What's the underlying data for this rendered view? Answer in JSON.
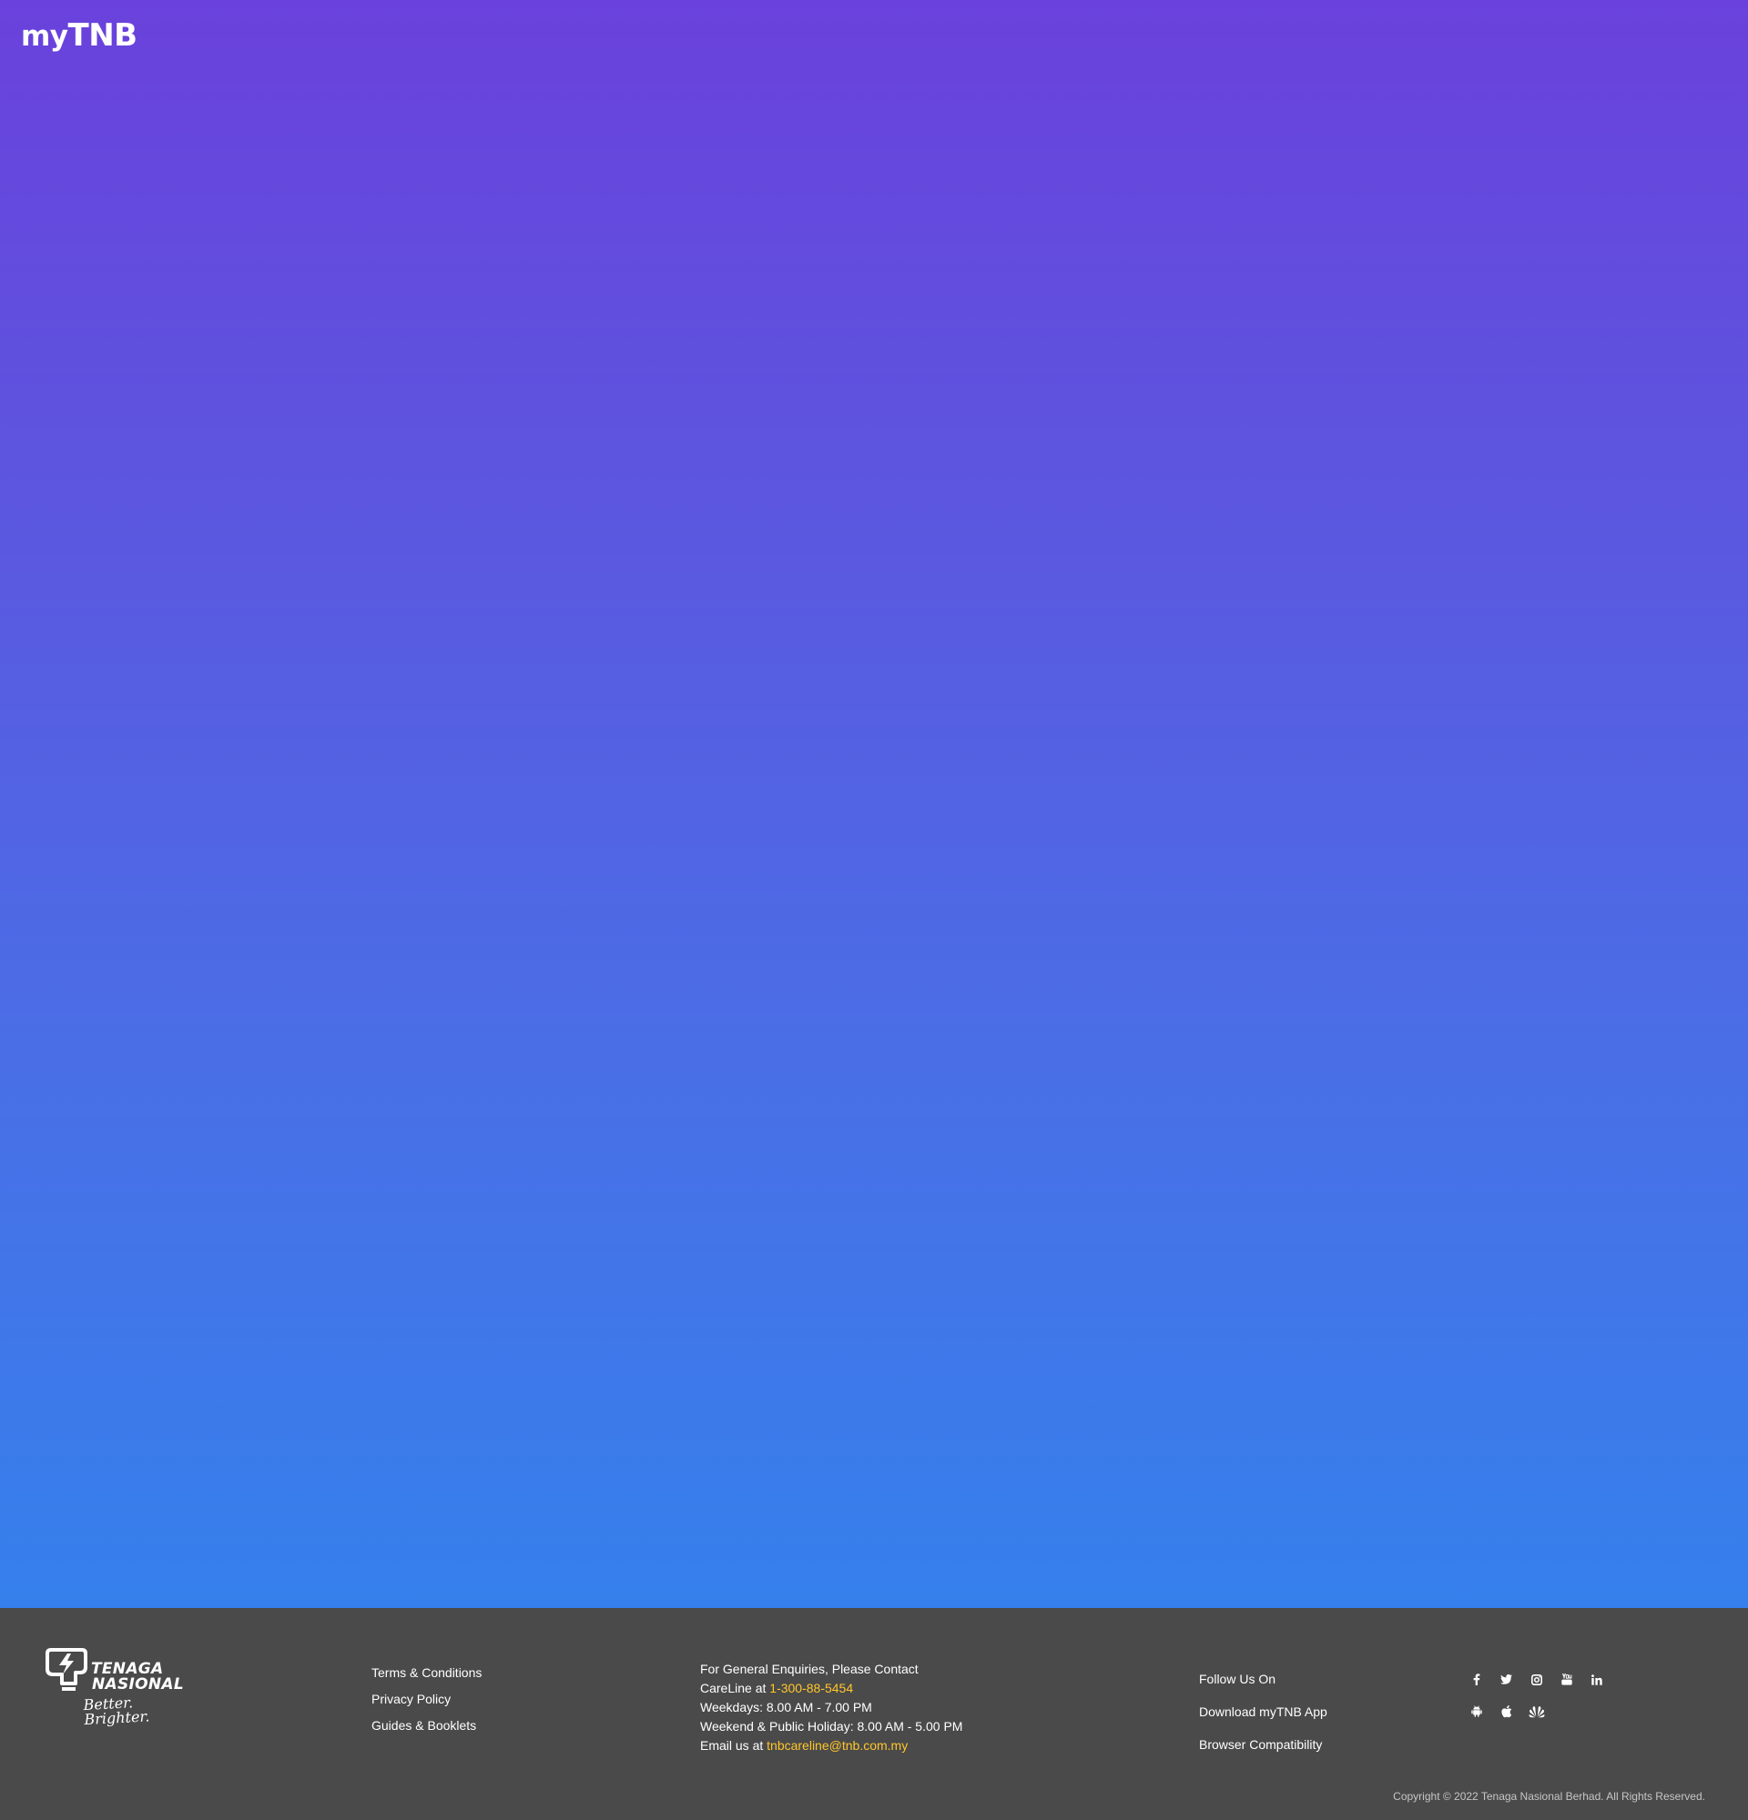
{
  "header": {
    "logo_my": "my",
    "logo_tnb": "TNB"
  },
  "footer": {
    "brand": {
      "line1": "TENAGA",
      "line2": "NASIONAL",
      "tagline": "Better. Brighter."
    },
    "links": [
      {
        "label": "Terms & Conditions"
      },
      {
        "label": "Privacy Policy"
      },
      {
        "label": "Guides & Booklets"
      }
    ],
    "contact": {
      "heading": "For General Enquiries, Please Contact",
      "careline_prefix": "CareLine at ",
      "careline_number": "1-300-88-5454",
      "weekdays": "Weekdays: 8.00 AM - 7.00 PM",
      "weekend": "Weekend & Public Holiday: 8.00 AM - 5.00 PM",
      "email_prefix": "Email us at ",
      "email": "tnbcareline@tnb.com.my"
    },
    "right": {
      "follow_label": "Follow Us On",
      "download_label": "Download myTNB App",
      "browser_label": "Browser Compatibility"
    },
    "social_icons": [
      "facebook-icon",
      "twitter-icon",
      "instagram-icon",
      "youtube-icon",
      "linkedin-icon"
    ],
    "app_icons": [
      "android-icon",
      "apple-icon",
      "huawei-icon"
    ],
    "copyright": "Copyright © 2022 Tenaga Nasional Berhad. All Rights Reserved."
  },
  "colors": {
    "gradient_top": "#6a41dc",
    "gradient_bottom": "#3580ec",
    "footer_bg": "#4a4a4a",
    "highlight": "#ffc62b"
  }
}
